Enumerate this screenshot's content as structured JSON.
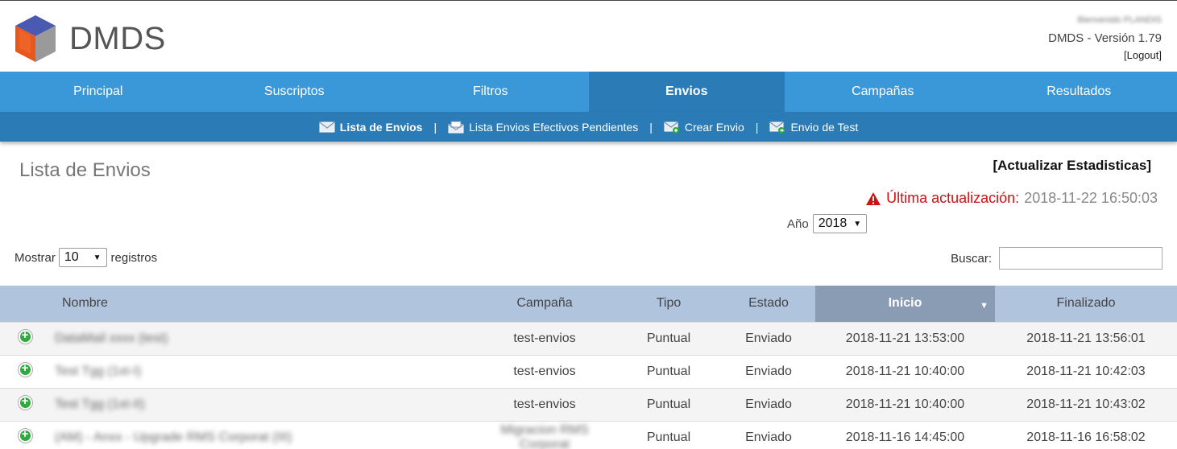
{
  "header": {
    "logo_text": "DMDS",
    "welcome": "Bienvenido PLANDIS",
    "version": "DMDS - Versión 1.79",
    "logout": "[Logout]"
  },
  "nav": {
    "items": [
      "Principal",
      "Suscriptos",
      "Filtros",
      "Envios",
      "Campañas",
      "Resultados"
    ],
    "active": "Envios"
  },
  "subnav": {
    "items": [
      "Lista de Envios",
      "Lista Envios Efectivos Pendientes",
      "Crear Envio",
      "Envio de Test"
    ],
    "separator": "|"
  },
  "content": {
    "title": "Lista de Envios",
    "refresh_label": "[Actualizar Estadisticas]",
    "last_update_label": "Última actualización:",
    "last_update_value": "2018-11-22 16:50:03",
    "year_label": "Año",
    "year_value": "2018",
    "show_label": "Mostrar",
    "show_value": "10",
    "records_label": "registros",
    "search_label": "Buscar:"
  },
  "table": {
    "headers": [
      "Nombre",
      "Campaña",
      "Tipo",
      "Estado",
      "Inicio",
      "Finalizado"
    ],
    "sorted_column": "Inicio",
    "rows": [
      {
        "nombre": "DataMail xxxx (test)",
        "campana": "test-envios",
        "tipo": "Puntual",
        "estado": "Enviado",
        "inicio": "2018-11-21 13:53:00",
        "finalizado": "2018-11-21 13:56:01"
      },
      {
        "nombre": "Test Tgg (1xt-I)",
        "campana": "test-envios",
        "tipo": "Puntual",
        "estado": "Enviado",
        "inicio": "2018-11-21 10:40:00",
        "finalizado": "2018-11-21 10:42:03"
      },
      {
        "nombre": "Test Tgg (1xt-II)",
        "campana": "test-envios",
        "tipo": "Puntual",
        "estado": "Enviado",
        "inicio": "2018-11-21 10:40:00",
        "finalizado": "2018-11-21 10:43:02"
      },
      {
        "nombre": "(AM) - Anxx - Upgrade RMS Corporat (III)",
        "campana": "Migracion RMS Corporat",
        "tipo": "Puntual",
        "estado": "Enviado",
        "inicio": "2018-11-16 14:45:00",
        "finalizado": "2018-11-16 16:58:02"
      }
    ]
  },
  "colors": {
    "nav_bg": "#3a97d8",
    "nav_active_bg": "#2a7bb6",
    "warning_red": "#d31010",
    "table_header_bg": "#b0c4de",
    "sorted_header_bg": "#8a9cb4",
    "expand_green": "#2eaa3e"
  }
}
